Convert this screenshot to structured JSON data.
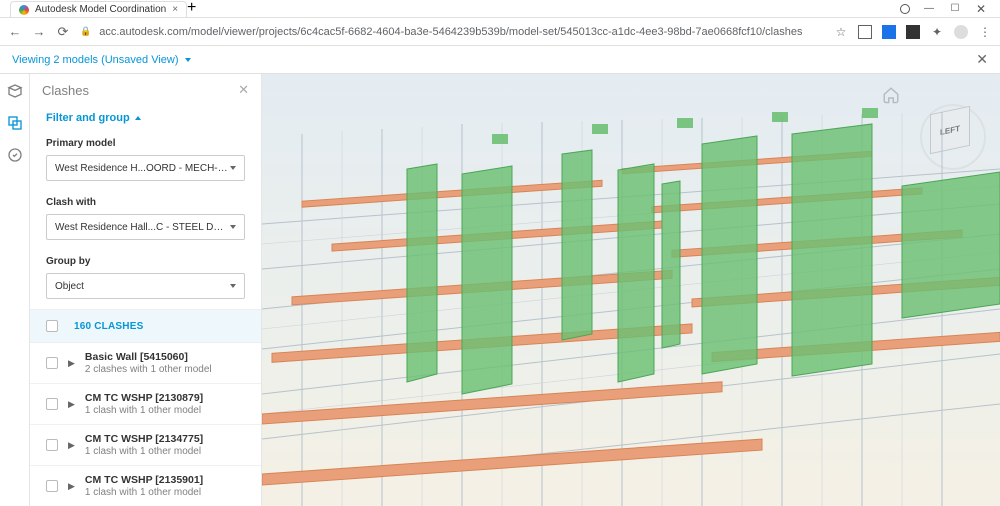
{
  "window": {
    "tab_title": "Autodesk Model Coordination",
    "url": "acc.autodesk.com/model/viewer/projects/6c4cac5f-6682-4604-ba3e-5464239b539b/model-set/545013cc-a1dc-4ee3-98bd-7ae0668fcf10/clashes"
  },
  "subheader": {
    "viewing_label": "Viewing 2 models (Unsaved View)"
  },
  "panel": {
    "title": "Clashes",
    "filter_label": "Filter and group",
    "primary_label": "Primary model",
    "primary_value": "West Residence H...OORD - MECH-DUCT",
    "clash_with_label": "Clash with",
    "clash_with_value": "West Residence Hall...C - STEEL DETAILING",
    "group_by_label": "Group by",
    "group_by_value": "Object",
    "summary": "160 CLASHES"
  },
  "clashes": [
    {
      "name": "Basic Wall [5415060]",
      "sub": "2 clashes with 1 other model"
    },
    {
      "name": "CM TC WSHP [2130879]",
      "sub": "1 clash with 1 other model"
    },
    {
      "name": "CM TC WSHP [2134775]",
      "sub": "1 clash with 1 other model"
    },
    {
      "name": "CM TC WSHP [2135901]",
      "sub": "1 clash with 1 other model"
    }
  ],
  "viewcube": {
    "face": "LEFT"
  }
}
